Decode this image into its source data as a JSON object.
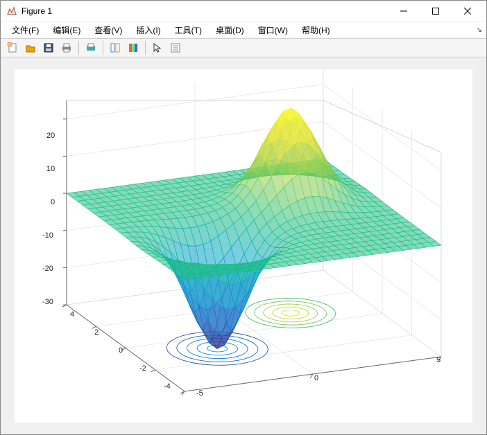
{
  "window": {
    "title": "Figure 1"
  },
  "menu": {
    "items": [
      "文件(F)",
      "编辑(E)",
      "查看(V)",
      "插入(I)",
      "工具(T)",
      "桌面(D)",
      "窗口(W)",
      "帮助(H)"
    ]
  },
  "toolbar": {
    "icons": [
      "new-figure",
      "open",
      "save",
      "print",
      "print-preview",
      "link-axes",
      "colorbar",
      "cursor",
      "data-cursor"
    ]
  },
  "chart_data": {
    "type": "surface",
    "description": "3D mesh surface with contour projection on the floor (z = -30). Surface is z = f(x,y) with a positive peak near (x≈2, y≈1) reaching about +25 and a negative dip near (x≈-2, y≈-1) reaching about -30; elsewhere z ≈ 0.",
    "x_range": [
      -5,
      5
    ],
    "y_range": [
      -4,
      4
    ],
    "z_range": [
      -30,
      25
    ],
    "x_ticks": [
      -5,
      0,
      5
    ],
    "y_ticks": [
      -4,
      -2,
      0,
      2,
      4
    ],
    "z_ticks": [
      -30,
      -20,
      -10,
      0,
      10,
      20
    ],
    "peak": {
      "x": 2,
      "y": 1,
      "z": 25
    },
    "trough": {
      "x": -2,
      "y": -1,
      "z": -30
    },
    "contour_floor_z": -30,
    "colormap": "parula-like (blue→teal→green→yellow)",
    "grid": true,
    "legend": null,
    "title": "",
    "xlabel": "",
    "ylabel": "",
    "zlabel": ""
  }
}
